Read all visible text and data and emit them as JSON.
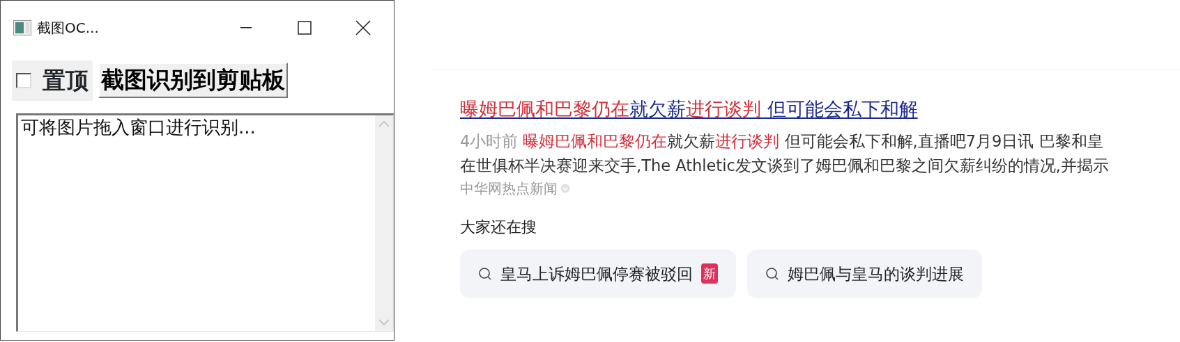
{
  "window": {
    "title": "截图OC...",
    "pin": {
      "label": "置顶",
      "checked": false
    },
    "ocr_button": "截图识别到剪贴板",
    "text_area": {
      "value": "可将图片拖入窗口进行识别..."
    }
  },
  "result": {
    "title": [
      {
        "text": "曝姆巴佩和巴黎仍在",
        "highlight": true
      },
      {
        "text": "就欠薪",
        "highlight": false
      },
      {
        "text": "进行谈判",
        "highlight": true
      },
      {
        "text": " 但可能会私下和解",
        "highlight": false
      }
    ],
    "time": "4小时前",
    "snippet_lines": [
      [
        {
          "text": "曝姆巴佩和巴黎仍在",
          "highlight": true
        },
        {
          "text": "就欠薪",
          "highlight": false
        },
        {
          "text": "进行谈判",
          "highlight": true
        },
        {
          "text": " 但可能会私下和解,直播吧7月9日讯 巴黎和皇",
          "highlight": false
        }
      ],
      [
        {
          "text": "在世俱杯半决赛迎来交手,The Athletic发文谈到了姆巴佩和巴黎之间欠薪纠纷的情况,并揭示",
          "highlight": false
        }
      ]
    ],
    "source": "中华网热点新闻"
  },
  "related": {
    "heading": "大家还在搜",
    "items": [
      {
        "text": "皇马上诉姆巴佩停赛被驳回",
        "badge": "新"
      },
      {
        "text": "姆巴佩与皇马的谈判进展"
      }
    ]
  }
}
